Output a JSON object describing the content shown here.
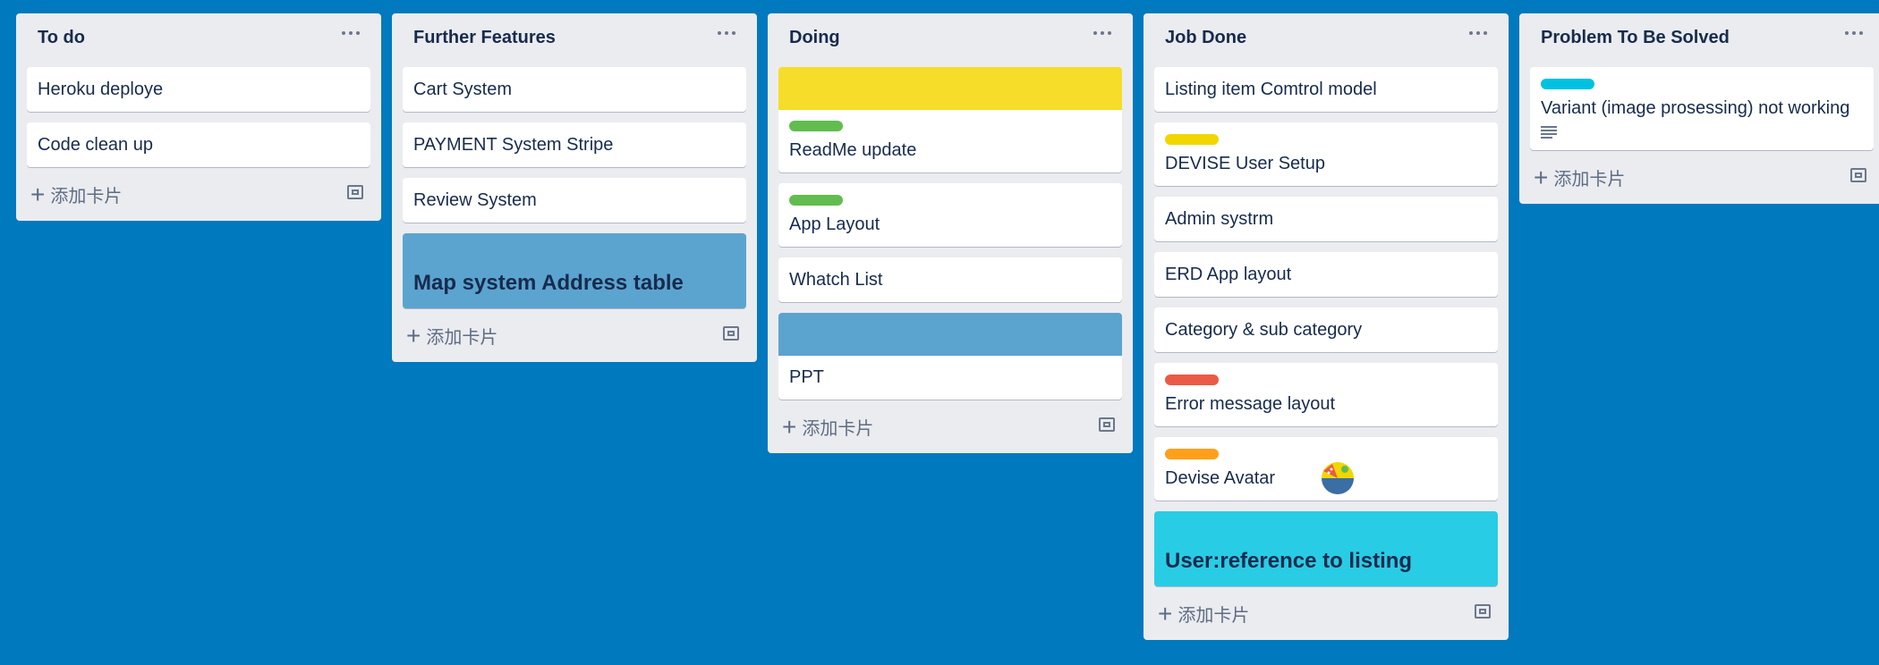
{
  "colors": {
    "board_bg": "#0079bf",
    "list_bg": "#ebecf0",
    "green": "#61bd4f",
    "yellow": "#f2d600",
    "orange": "#ff9f1a",
    "red": "#eb5a46",
    "sky": "#00c2e0",
    "blue_cover": "#5ba4cf",
    "cyan_cover": "#29cce5"
  },
  "add_card_label": "添加卡片",
  "lists": [
    {
      "title": "To do",
      "cards": [
        {
          "text": "Heroku deploye"
        },
        {
          "text": "Code clean up"
        }
      ]
    },
    {
      "title": "Further Features",
      "cards": [
        {
          "text": "Cart System"
        },
        {
          "text": "PAYMENT System Stripe"
        },
        {
          "text": "Review System"
        },
        {
          "text": "Map system Address table",
          "cover": "blue_cover",
          "full_cover": true
        }
      ]
    },
    {
      "title": "Doing",
      "cards": [
        {
          "text": "ReadMe update",
          "cover": "yellow",
          "label": "green"
        },
        {
          "text": "App Layout",
          "label": "green"
        },
        {
          "text": "Whatch List"
        },
        {
          "text": "PPT",
          "cover": "blue_cover"
        }
      ]
    },
    {
      "title": "Job Done",
      "cards": [
        {
          "text": "Listing item Comtrol model"
        },
        {
          "text": "DEVISE User Setup",
          "label": "yellow"
        },
        {
          "text": "Admin systrm"
        },
        {
          "text": "ERD App layout"
        },
        {
          "text": "Category & sub category"
        },
        {
          "text": "Error message layout",
          "label": "red"
        },
        {
          "text": "Devise Avatar",
          "label": "orange"
        },
        {
          "text": "User:reference to listing",
          "cover": "cyan_cover",
          "full_cover": true
        }
      ]
    },
    {
      "title": "Problem To Be Solved",
      "cards": [
        {
          "text": "Variant (image prosessing) not working",
          "label": "sky",
          "has_description": true
        }
      ]
    }
  ]
}
